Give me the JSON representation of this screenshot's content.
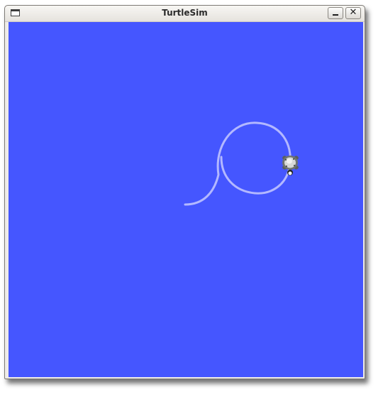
{
  "window": {
    "title": "TurtleSim"
  },
  "icons": {
    "menu": "window-menu-icon",
    "minimize": "minimize-icon",
    "close": "close-icon"
  },
  "buttons": {
    "close_glyph": "✕"
  },
  "canvas": {
    "background_color": "#4556ff",
    "pen_color": "#b3b8ff"
  }
}
